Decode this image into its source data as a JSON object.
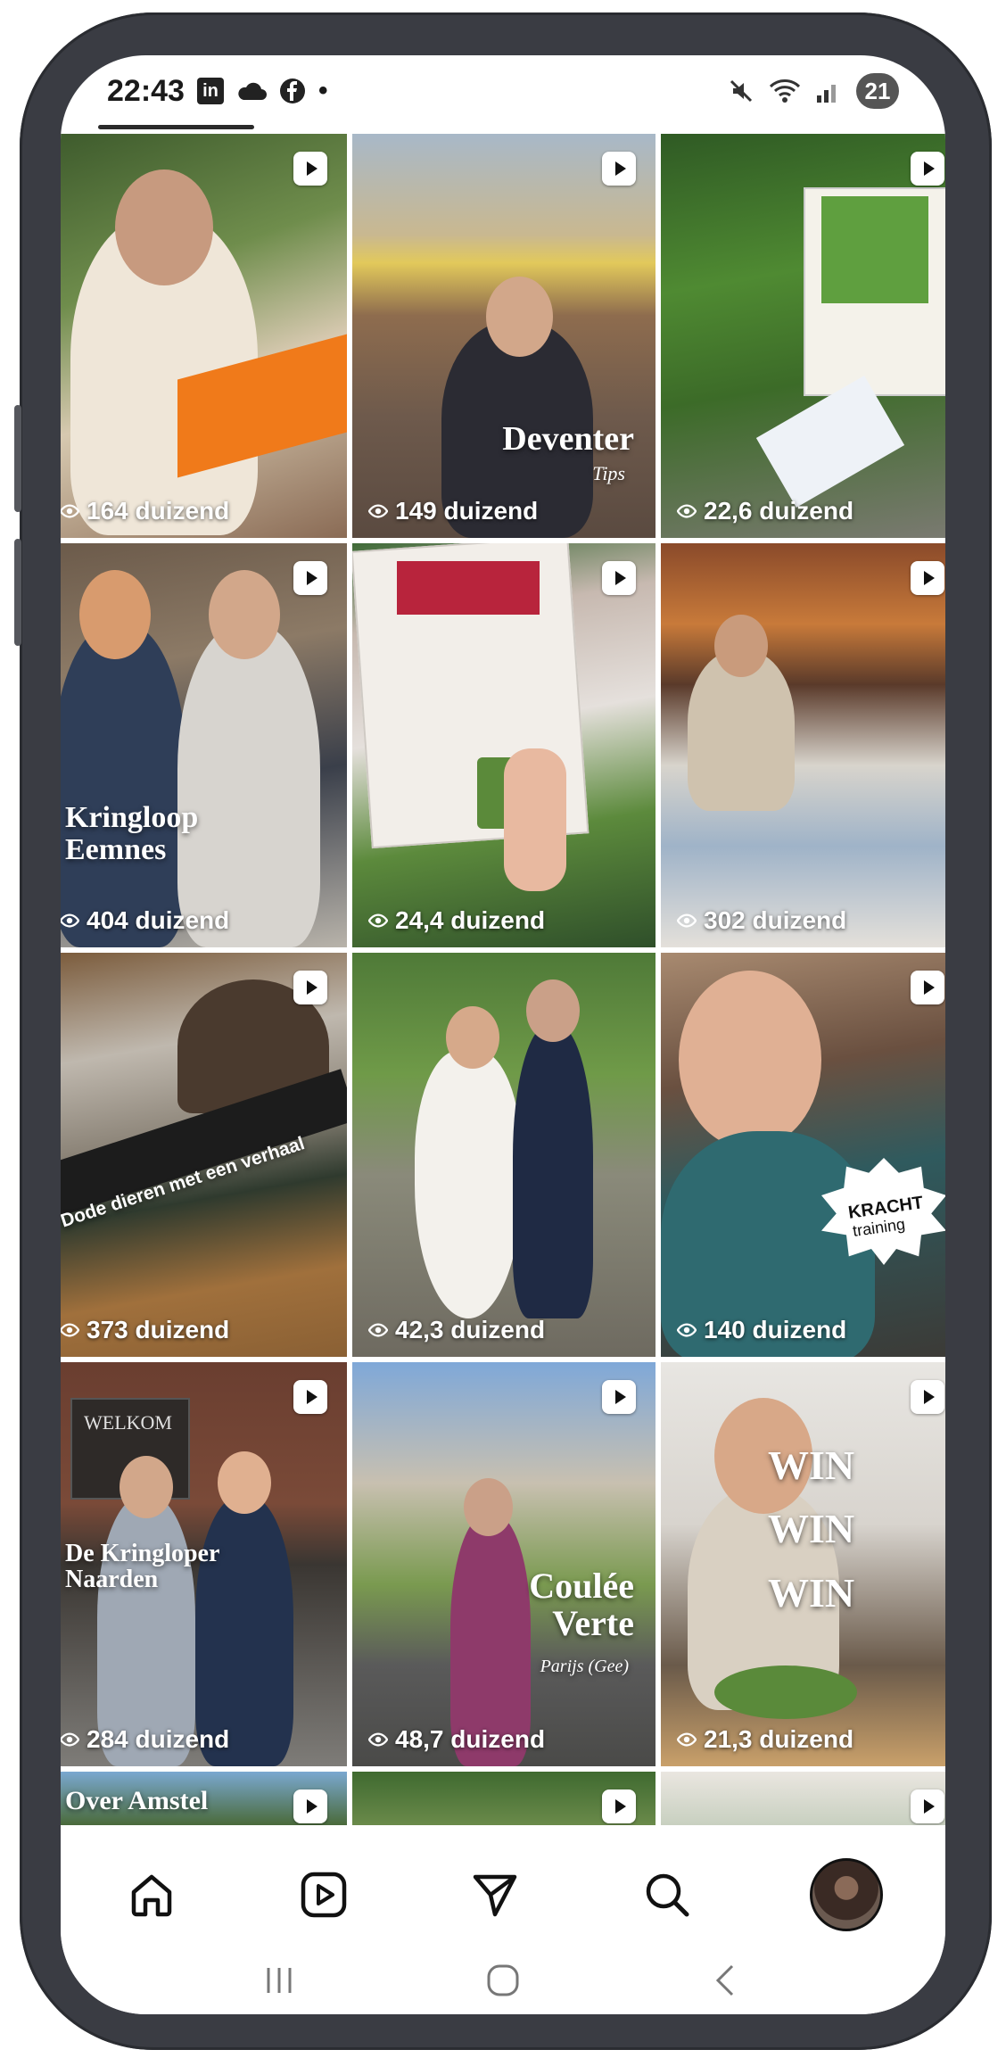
{
  "status_bar": {
    "time": "22:43",
    "left_icons": [
      "linkedin-icon",
      "cloud-icon",
      "facebook-icon",
      "dot-icon"
    ],
    "right_icons": [
      "mute-icon",
      "wifi-icon",
      "signal-icon"
    ],
    "battery": "21"
  },
  "tiles": [
    {
      "views": "164 duizend",
      "overlay": ""
    },
    {
      "views": "149 duizend",
      "overlay": "Deventer",
      "overlay_sub": "Tips"
    },
    {
      "views": "22,6 duizend",
      "overlay": ""
    },
    {
      "views": "404 duizend",
      "overlay": "Kringloop\nEemnes"
    },
    {
      "views": "24,4 duizend",
      "overlay": ""
    },
    {
      "views": "302 duizend",
      "overlay": ""
    },
    {
      "views": "373 duizend",
      "overlay": "Dode dieren met een verhaal"
    },
    {
      "views": "42,3 duizend",
      "overlay": ""
    },
    {
      "views": "140 duizend",
      "overlay": "KRACHT",
      "overlay_sub": "training"
    },
    {
      "views": "284 duizend",
      "overlay": "De Kringloper\nNaarden",
      "sign": "WELKOM"
    },
    {
      "views": "48,7 duizend",
      "overlay": "Coulée\nVerte",
      "overlay_sub": "Parijs (Gee)"
    },
    {
      "views": "21,3 duizend",
      "overlay": "WIN\nWIN\nWIN"
    },
    {
      "views": "",
      "overlay": "Over Amstel"
    },
    {
      "views": "",
      "overlay": ""
    },
    {
      "views": "",
      "overlay": ""
    }
  ],
  "bottom_nav": [
    "home-icon",
    "reels-icon",
    "direct-icon",
    "search-icon",
    "profile-avatar"
  ],
  "system_nav": [
    "recents-icon",
    "home-button-icon",
    "back-icon"
  ]
}
